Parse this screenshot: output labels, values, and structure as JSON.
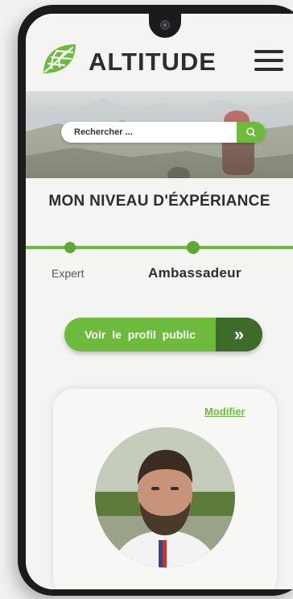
{
  "header": {
    "brand": "ALTITUDE",
    "logo_icon": "leaf-net-icon",
    "menu_icon": "hamburger-menu-icon"
  },
  "search": {
    "placeholder": "Rechercher ...",
    "icon": "search-icon"
  },
  "level": {
    "title": "MON NIVEAU D'ÉXPÉRIANCE",
    "steps": [
      {
        "label": "Expert"
      },
      {
        "label": "Ambassadeur"
      }
    ]
  },
  "profile_button": {
    "label": "Voir le profil public",
    "icon": "double-chevron-right-icon"
  },
  "card": {
    "edit_label": "Modifier"
  },
  "colors": {
    "accent": "#6dbb3d",
    "accent_dark": "#3d6b2a",
    "text": "#2d2d2d"
  }
}
